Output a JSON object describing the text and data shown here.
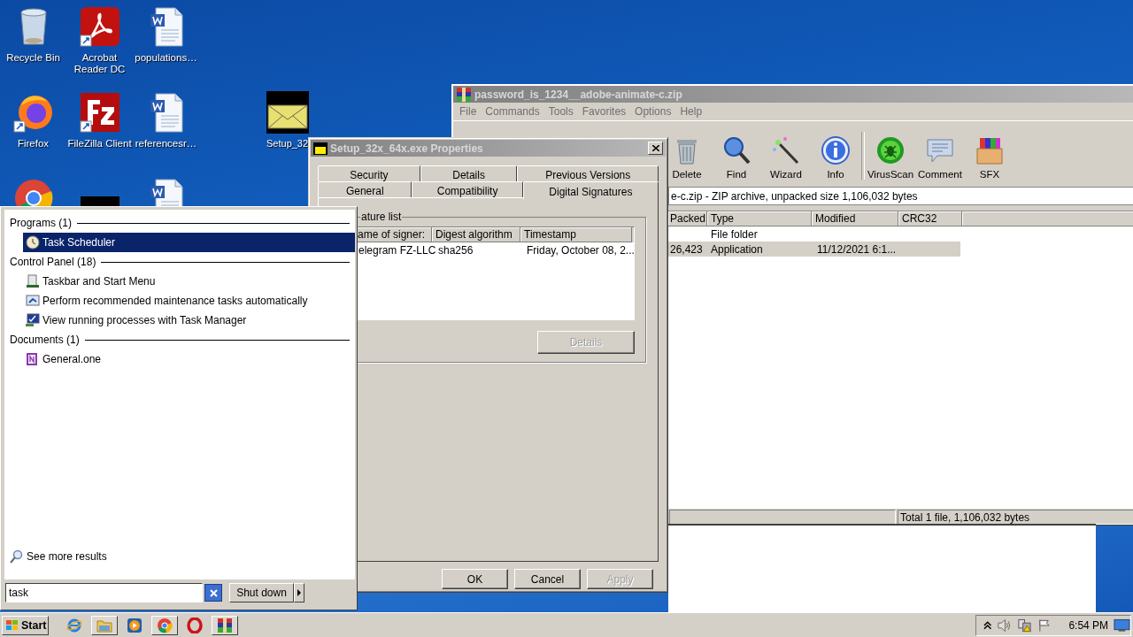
{
  "desktop": {
    "icons": [
      {
        "label": "Recycle Bin",
        "kind": "bin"
      },
      {
        "label": "Acrobat Reader DC",
        "kind": "acrobat"
      },
      {
        "label": "populations…",
        "kind": "word"
      },
      {
        "label": "Firefox",
        "kind": "firefox"
      },
      {
        "label": "FileZilla Client",
        "kind": "filezilla"
      },
      {
        "label": "referencesr…",
        "kind": "word"
      },
      {
        "label": "Setup_32",
        "kind": "setup"
      },
      {
        "kind": "chrome"
      },
      {
        "kind": "black"
      },
      {
        "kind": "word"
      }
    ]
  },
  "archive_window": {
    "title": "password_is_1234__adobe-animate-c.zip",
    "menu": [
      "File",
      "Commands",
      "Tools",
      "Favorites",
      "Options",
      "Help"
    ],
    "toolbar": [
      {
        "label": "Delete",
        "kind": "delete"
      },
      {
        "label": "Find",
        "kind": "find"
      },
      {
        "label": "Wizard",
        "kind": "wizard"
      },
      {
        "label": "Info",
        "kind": "info"
      },
      {
        "label": "VirusScan",
        "kind": "virus"
      },
      {
        "label": "Comment",
        "kind": "comment"
      },
      {
        "label": "SFX",
        "kind": "sfx"
      }
    ],
    "path": "e-c.zip - ZIP archive, unpacked size 1,106,032 bytes",
    "columns": [
      "Packed",
      "Type",
      "Modified",
      "CRC32"
    ],
    "rows": [
      {
        "type": "File folder",
        "selected": false
      },
      {
        "packed": "26,423",
        "type": "Application",
        "modified": "11/12/2021 6:1...",
        "selected": true
      }
    ],
    "status": "Total 1 file, 1,106,032 bytes"
  },
  "properties_dialog": {
    "title": "Setup_32x_64x.exe Properties",
    "tab_rows": [
      {
        "tabs": [
          {
            "label": "Security",
            "selected": false
          },
          {
            "label": "Details",
            "selected": false
          },
          {
            "label": "Previous Versions",
            "selected": false
          }
        ]
      },
      {
        "tabs": [
          {
            "label": "General",
            "selected": false
          },
          {
            "label": "Compatibility",
            "selected": false
          },
          {
            "label": "Digital Signatures",
            "selected": true
          }
        ]
      }
    ],
    "group_label": "ature list",
    "columns": [
      "ame of signer:",
      "Digest algorithm",
      "Timestamp"
    ],
    "rows": [
      {
        "signer": "elegram FZ-LLC",
        "digest": "sha256",
        "timestamp": "Friday, October 08, 2..."
      }
    ],
    "details_button": {
      "label": "Details",
      "disabled": true
    },
    "buttons": [
      {
        "label": "OK",
        "disabled": false
      },
      {
        "label": "Cancel",
        "disabled": false
      },
      {
        "label": "Apply",
        "disabled": true
      }
    ]
  },
  "start_menu": {
    "sections": [
      {
        "heading": "Programs (1)",
        "items": [
          {
            "label": "Task Scheduler",
            "kind": "clock",
            "selected": true
          }
        ]
      },
      {
        "heading": "Control Panel (18)",
        "items": [
          {
            "label": "Taskbar and Start Menu",
            "kind": "taskbar",
            "selected": false
          },
          {
            "label": "Perform recommended maintenance tasks automatically",
            "kind": "maintenance",
            "selected": false
          },
          {
            "label": "View running processes with Task Manager",
            "kind": "taskmgr",
            "selected": false
          }
        ]
      },
      {
        "heading": "Documents (1)",
        "items": [
          {
            "label": "General.one",
            "kind": "onenote",
            "selected": false
          }
        ]
      }
    ],
    "more_results": "See more results",
    "search": {
      "value": "task"
    },
    "shutdown": "Shut down"
  },
  "taskbar": {
    "start": "Start",
    "apps": [
      {
        "kind": "ie",
        "running": false
      },
      {
        "kind": "explorer",
        "running": true
      },
      {
        "kind": "media",
        "running": false
      },
      {
        "kind": "chrome",
        "running": true
      },
      {
        "kind": "opera",
        "running": false
      },
      {
        "kind": "winrar",
        "running": true
      }
    ],
    "clock": "6:54 PM"
  }
}
